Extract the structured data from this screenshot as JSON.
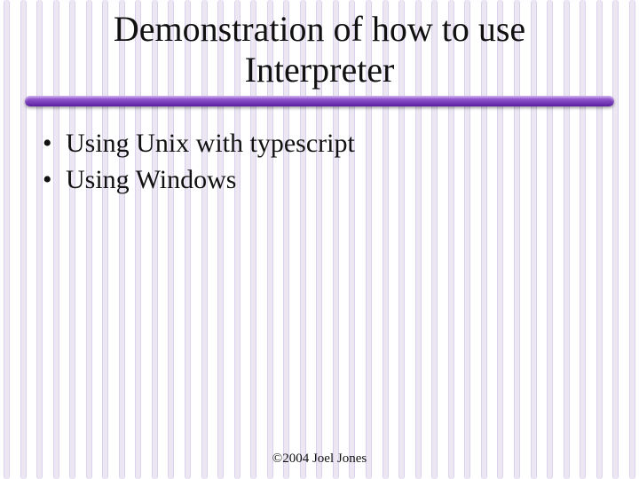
{
  "title": "Demonstration of how to use Interpreter",
  "bullets": [
    "Using Unix with typescript",
    "Using Windows"
  ],
  "footer": "©2004 Joel Jones"
}
